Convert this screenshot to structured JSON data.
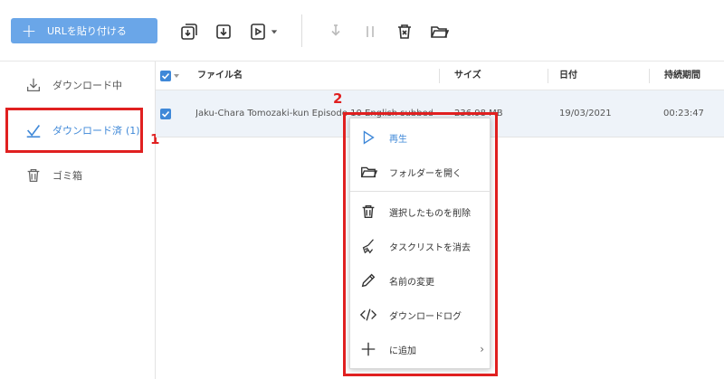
{
  "toolbar": {
    "paste_label": "URLを貼り付ける",
    "icons": [
      "download-batch-icon",
      "download-icon",
      "video-download-icon",
      "dropdown-icon",
      "pause-download-icon",
      "pause-icon",
      "delete-icon",
      "folder-open-icon"
    ]
  },
  "sidebar": {
    "items": [
      {
        "label": "ダウンロード中",
        "icon": "download-icon"
      },
      {
        "label": "ダウンロード済",
        "count": "(1)",
        "icon": "check-icon"
      },
      {
        "label": "ゴミ箱",
        "icon": "trash-icon"
      }
    ]
  },
  "table": {
    "columns": [
      "ファイル名",
      "サイズ",
      "日付",
      "持続期間"
    ],
    "rows": [
      {
        "name": "Jaku-Chara Tomozaki-kun Episode 10 English subbed",
        "size": "236.98 MB",
        "date": "19/03/2021",
        "duration": "00:23:47"
      }
    ]
  },
  "context_menu": {
    "items": [
      {
        "label": "再生",
        "icon": "play-icon"
      },
      {
        "label": "フォルダーを開く",
        "icon": "folder-icon"
      },
      {
        "label": "選択したものを削除",
        "icon": "trash-icon"
      },
      {
        "label": "タスクリストを消去",
        "icon": "broom-icon"
      },
      {
        "label": "名前の変更",
        "icon": "pencil-icon"
      },
      {
        "label": "ダウンロードログ",
        "icon": "code-icon"
      },
      {
        "label": "に追加",
        "icon": "plus-icon",
        "submenu_arrow": "›"
      }
    ]
  },
  "annotations": {
    "one": "1",
    "two": "2"
  },
  "colors": {
    "accent": "#3f88d8",
    "button": "#6aa6e8",
    "highlight": "#e02020",
    "row_selected": "#eef3f9"
  }
}
